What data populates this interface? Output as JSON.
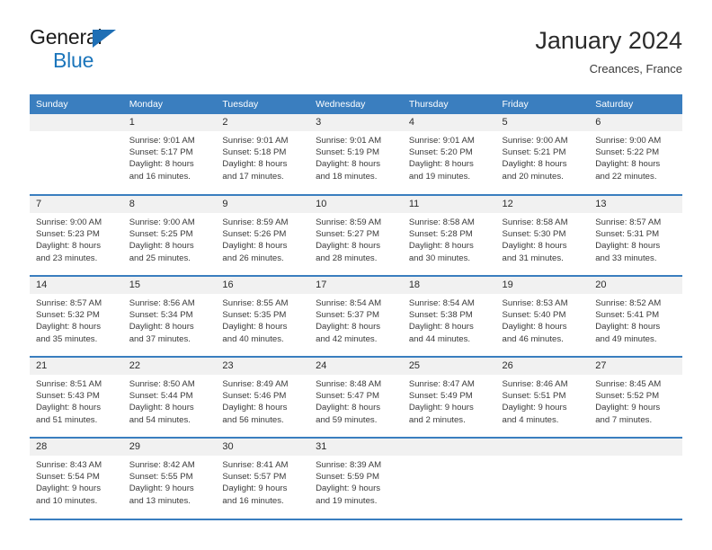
{
  "brand": {
    "name_top": "General",
    "name_bottom": "Blue",
    "colors": {
      "dark": "#1a1a1a",
      "blue": "#1b75bb",
      "triangle": "#1f6fb5"
    }
  },
  "header": {
    "title": "January 2024",
    "subtitle": "Creances, France"
  },
  "theme": {
    "header_row_bg": "#3a7ebf",
    "header_row_text": "#ffffff",
    "daynum_bg": "#f1f1f1",
    "cell_bg": "#ffffff",
    "text": "#3a3a3a"
  },
  "calendar": {
    "weekday_headers": [
      "Sunday",
      "Monday",
      "Tuesday",
      "Wednesday",
      "Thursday",
      "Friday",
      "Saturday"
    ],
    "labels": {
      "sunrise": "Sunrise:",
      "sunset": "Sunset:",
      "daylight": "Daylight:"
    },
    "weeks": [
      [
        {
          "day": "",
          "lines": []
        },
        {
          "day": "1",
          "lines": [
            "Sunrise: 9:01 AM",
            "Sunset: 5:17 PM",
            "Daylight: 8 hours",
            "and 16 minutes."
          ]
        },
        {
          "day": "2",
          "lines": [
            "Sunrise: 9:01 AM",
            "Sunset: 5:18 PM",
            "Daylight: 8 hours",
            "and 17 minutes."
          ]
        },
        {
          "day": "3",
          "lines": [
            "Sunrise: 9:01 AM",
            "Sunset: 5:19 PM",
            "Daylight: 8 hours",
            "and 18 minutes."
          ]
        },
        {
          "day": "4",
          "lines": [
            "Sunrise: 9:01 AM",
            "Sunset: 5:20 PM",
            "Daylight: 8 hours",
            "and 19 minutes."
          ]
        },
        {
          "day": "5",
          "lines": [
            "Sunrise: 9:00 AM",
            "Sunset: 5:21 PM",
            "Daylight: 8 hours",
            "and 20 minutes."
          ]
        },
        {
          "day": "6",
          "lines": [
            "Sunrise: 9:00 AM",
            "Sunset: 5:22 PM",
            "Daylight: 8 hours",
            "and 22 minutes."
          ]
        }
      ],
      [
        {
          "day": "7",
          "lines": [
            "Sunrise: 9:00 AM",
            "Sunset: 5:23 PM",
            "Daylight: 8 hours",
            "and 23 minutes."
          ]
        },
        {
          "day": "8",
          "lines": [
            "Sunrise: 9:00 AM",
            "Sunset: 5:25 PM",
            "Daylight: 8 hours",
            "and 25 minutes."
          ]
        },
        {
          "day": "9",
          "lines": [
            "Sunrise: 8:59 AM",
            "Sunset: 5:26 PM",
            "Daylight: 8 hours",
            "and 26 minutes."
          ]
        },
        {
          "day": "10",
          "lines": [
            "Sunrise: 8:59 AM",
            "Sunset: 5:27 PM",
            "Daylight: 8 hours",
            "and 28 minutes."
          ]
        },
        {
          "day": "11",
          "lines": [
            "Sunrise: 8:58 AM",
            "Sunset: 5:28 PM",
            "Daylight: 8 hours",
            "and 30 minutes."
          ]
        },
        {
          "day": "12",
          "lines": [
            "Sunrise: 8:58 AM",
            "Sunset: 5:30 PM",
            "Daylight: 8 hours",
            "and 31 minutes."
          ]
        },
        {
          "day": "13",
          "lines": [
            "Sunrise: 8:57 AM",
            "Sunset: 5:31 PM",
            "Daylight: 8 hours",
            "and 33 minutes."
          ]
        }
      ],
      [
        {
          "day": "14",
          "lines": [
            "Sunrise: 8:57 AM",
            "Sunset: 5:32 PM",
            "Daylight: 8 hours",
            "and 35 minutes."
          ]
        },
        {
          "day": "15",
          "lines": [
            "Sunrise: 8:56 AM",
            "Sunset: 5:34 PM",
            "Daylight: 8 hours",
            "and 37 minutes."
          ]
        },
        {
          "day": "16",
          "lines": [
            "Sunrise: 8:55 AM",
            "Sunset: 5:35 PM",
            "Daylight: 8 hours",
            "and 40 minutes."
          ]
        },
        {
          "day": "17",
          "lines": [
            "Sunrise: 8:54 AM",
            "Sunset: 5:37 PM",
            "Daylight: 8 hours",
            "and 42 minutes."
          ]
        },
        {
          "day": "18",
          "lines": [
            "Sunrise: 8:54 AM",
            "Sunset: 5:38 PM",
            "Daylight: 8 hours",
            "and 44 minutes."
          ]
        },
        {
          "day": "19",
          "lines": [
            "Sunrise: 8:53 AM",
            "Sunset: 5:40 PM",
            "Daylight: 8 hours",
            "and 46 minutes."
          ]
        },
        {
          "day": "20",
          "lines": [
            "Sunrise: 8:52 AM",
            "Sunset: 5:41 PM",
            "Daylight: 8 hours",
            "and 49 minutes."
          ]
        }
      ],
      [
        {
          "day": "21",
          "lines": [
            "Sunrise: 8:51 AM",
            "Sunset: 5:43 PM",
            "Daylight: 8 hours",
            "and 51 minutes."
          ]
        },
        {
          "day": "22",
          "lines": [
            "Sunrise: 8:50 AM",
            "Sunset: 5:44 PM",
            "Daylight: 8 hours",
            "and 54 minutes."
          ]
        },
        {
          "day": "23",
          "lines": [
            "Sunrise: 8:49 AM",
            "Sunset: 5:46 PM",
            "Daylight: 8 hours",
            "and 56 minutes."
          ]
        },
        {
          "day": "24",
          "lines": [
            "Sunrise: 8:48 AM",
            "Sunset: 5:47 PM",
            "Daylight: 8 hours",
            "and 59 minutes."
          ]
        },
        {
          "day": "25",
          "lines": [
            "Sunrise: 8:47 AM",
            "Sunset: 5:49 PM",
            "Daylight: 9 hours",
            "and 2 minutes."
          ]
        },
        {
          "day": "26",
          "lines": [
            "Sunrise: 8:46 AM",
            "Sunset: 5:51 PM",
            "Daylight: 9 hours",
            "and 4 minutes."
          ]
        },
        {
          "day": "27",
          "lines": [
            "Sunrise: 8:45 AM",
            "Sunset: 5:52 PM",
            "Daylight: 9 hours",
            "and 7 minutes."
          ]
        }
      ],
      [
        {
          "day": "28",
          "lines": [
            "Sunrise: 8:43 AM",
            "Sunset: 5:54 PM",
            "Daylight: 9 hours",
            "and 10 minutes."
          ]
        },
        {
          "day": "29",
          "lines": [
            "Sunrise: 8:42 AM",
            "Sunset: 5:55 PM",
            "Daylight: 9 hours",
            "and 13 minutes."
          ]
        },
        {
          "day": "30",
          "lines": [
            "Sunrise: 8:41 AM",
            "Sunset: 5:57 PM",
            "Daylight: 9 hours",
            "and 16 minutes."
          ]
        },
        {
          "day": "31",
          "lines": [
            "Sunrise: 8:39 AM",
            "Sunset: 5:59 PM",
            "Daylight: 9 hours",
            "and 19 minutes."
          ]
        },
        {
          "day": "",
          "lines": []
        },
        {
          "day": "",
          "lines": []
        },
        {
          "day": "",
          "lines": []
        }
      ]
    ]
  }
}
